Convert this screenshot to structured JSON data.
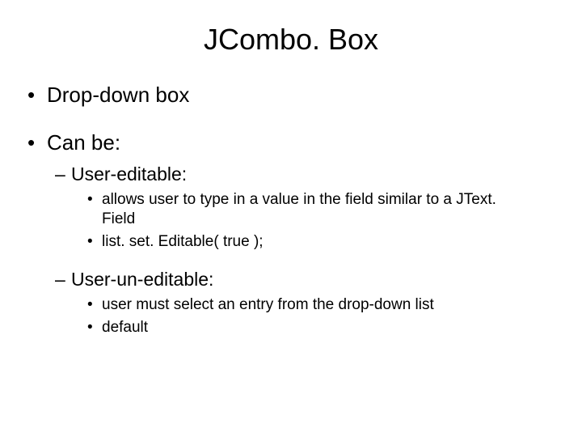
{
  "title": "JCombo. Box",
  "bullets": {
    "b1": "Drop-down box",
    "b2": "Can be:",
    "b2_1": "User-editable:",
    "b2_1_1": "allows user to type in a value in the field similar to a JText. Field",
    "b2_1_2": "list. set. Editable( true );",
    "b2_2": "User-un-editable:",
    "b2_2_1": "user must select an entry from the drop-down list",
    "b2_2_2": "default"
  }
}
